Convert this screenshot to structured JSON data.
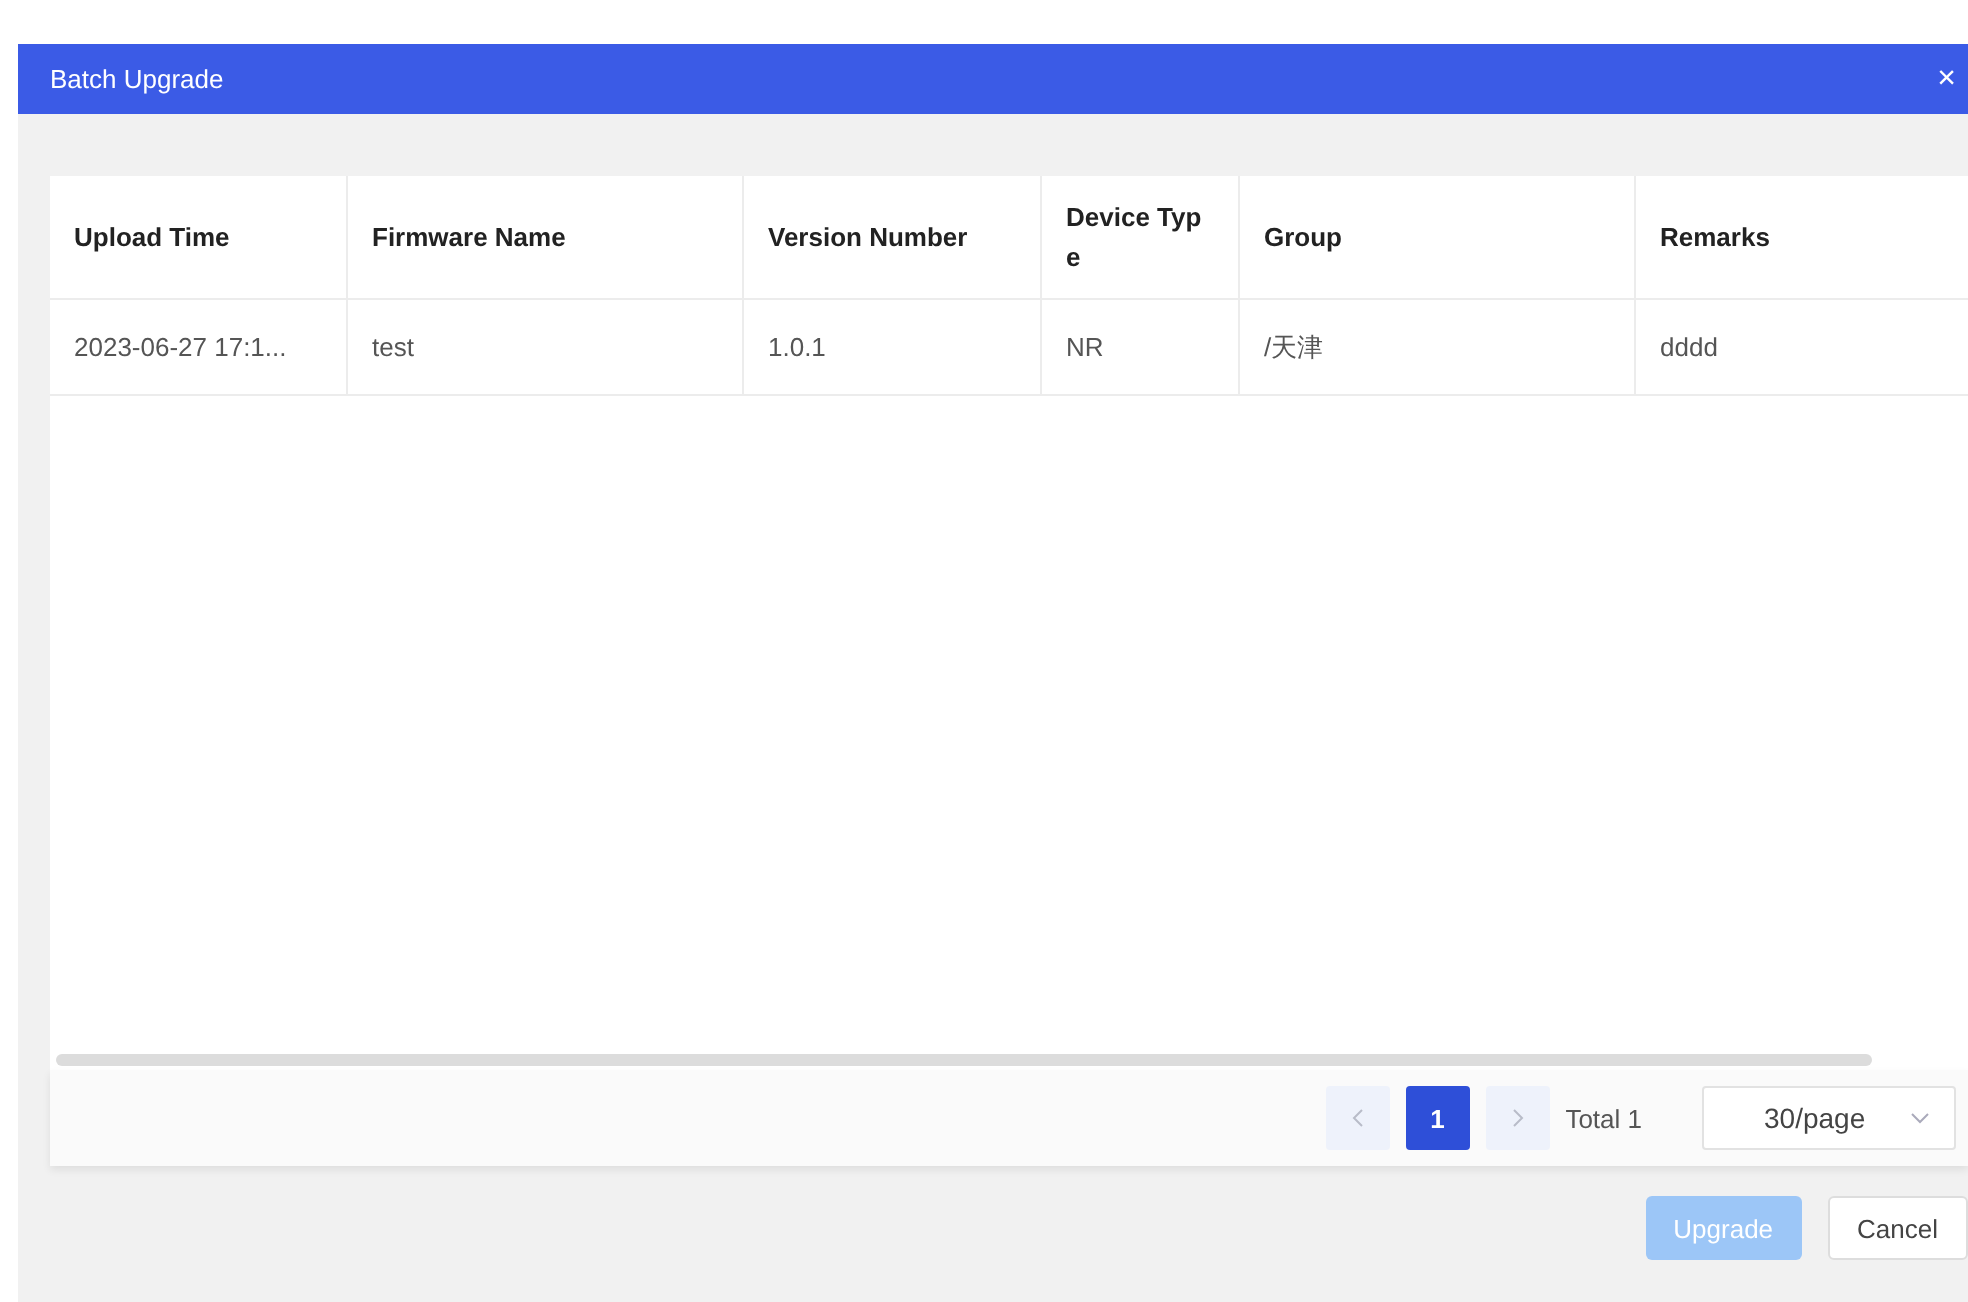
{
  "dialog": {
    "title": "Batch Upgrade",
    "close": "×"
  },
  "table": {
    "columns": [
      "Upload Time",
      "Firmware Name",
      "Version Number",
      "Device Type",
      "Group",
      "Remarks"
    ],
    "rows": [
      [
        "2023-06-27 17:1...",
        "test",
        "1.0.1",
        "NR",
        "/天津",
        "dddd"
      ]
    ]
  },
  "pagination": {
    "prev": {
      "disabled": true
    },
    "pages": [
      {
        "label": "1",
        "selected": true
      }
    ],
    "next": {
      "disabled": true
    },
    "total": "Total 1",
    "page_size": "30/page"
  },
  "buttons": [
    {
      "label": "Upgrade",
      "kind": "primary",
      "disabled": true
    },
    {
      "label": "Cancel",
      "kind": "default",
      "disabled": false
    }
  ]
}
